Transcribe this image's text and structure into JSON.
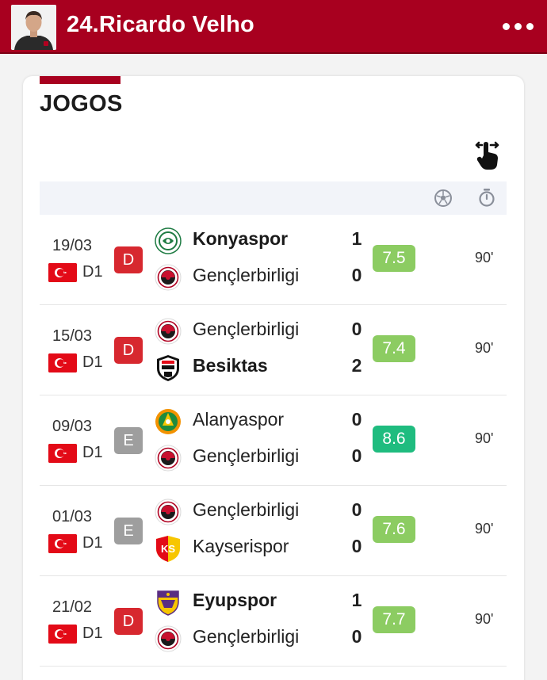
{
  "header": {
    "title": "24.Ricardo Velho",
    "background_color": "#a8001f"
  },
  "section": {
    "title": "JOGOS"
  },
  "colors": {
    "result_loss": "#d7282f",
    "result_draw": "#9e9e9e",
    "rating_good": "#8ccc62",
    "rating_very_good": "#1fbc7f"
  },
  "matches": [
    {
      "date": "19/03",
      "competition": "D1",
      "result": "D",
      "home_team": "Konyaspor",
      "home_score": "1",
      "home_logo": "konyaspor-logo",
      "away_team": "Gençlerbirligi",
      "away_score": "0",
      "away_logo": "genclerbirligi-logo",
      "winner": "home",
      "rating": "7.5",
      "minutes": "90'"
    },
    {
      "date": "15/03",
      "competition": "D1",
      "result": "D",
      "home_team": "Gençlerbirligi",
      "home_score": "0",
      "home_logo": "genclerbirligi-logo",
      "away_team": "Besiktas",
      "away_score": "2",
      "away_logo": "besiktas-logo",
      "winner": "away",
      "rating": "7.4",
      "minutes": "90'"
    },
    {
      "date": "09/03",
      "competition": "D1",
      "result": "E",
      "home_team": "Alanyaspor",
      "home_score": "0",
      "home_logo": "alanyaspor-logo",
      "away_team": "Gençlerbirligi",
      "away_score": "0",
      "away_logo": "genclerbirligi-logo",
      "winner": "none",
      "rating": "8.6",
      "minutes": "90'"
    },
    {
      "date": "01/03",
      "competition": "D1",
      "result": "E",
      "home_team": "Gençlerbirligi",
      "home_score": "0",
      "home_logo": "genclerbirligi-logo",
      "away_team": "Kayserispor",
      "away_score": "0",
      "away_logo": "kayserispor-logo",
      "winner": "none",
      "rating": "7.6",
      "minutes": "90'"
    },
    {
      "date": "21/02",
      "competition": "D1",
      "result": "D",
      "home_team": "Eyupspor",
      "home_score": "1",
      "home_logo": "eyupspor-logo",
      "away_team": "Gençlerbirligi",
      "away_score": "0",
      "away_logo": "genclerbirligi-logo",
      "winner": "home",
      "rating": "7.7",
      "minutes": "90'"
    }
  ]
}
